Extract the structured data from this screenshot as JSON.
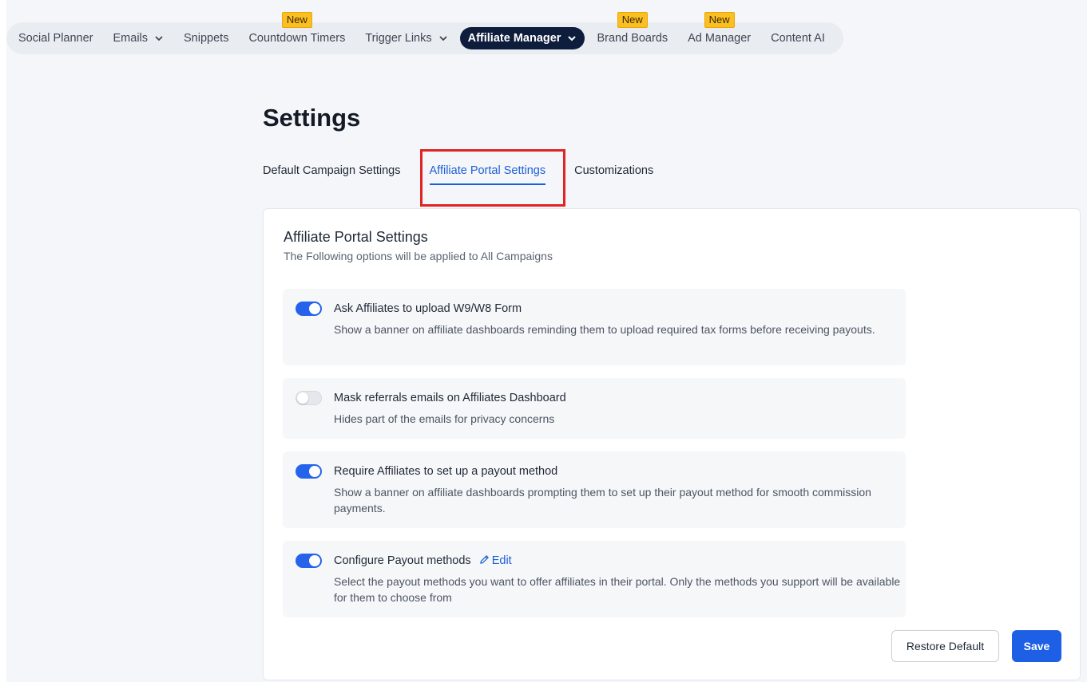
{
  "nav": {
    "items": [
      {
        "label": "Social Planner",
        "badge": "",
        "dropdown": false
      },
      {
        "label": "Emails",
        "badge": "",
        "dropdown": true
      },
      {
        "label": "Snippets",
        "badge": "",
        "dropdown": false
      },
      {
        "label": "Countdown Timers",
        "badge": "New",
        "dropdown": false
      },
      {
        "label": "Trigger Links",
        "badge": "",
        "dropdown": true
      },
      {
        "label": "Affiliate Manager",
        "badge": "",
        "dropdown": true
      },
      {
        "label": "Brand Boards",
        "badge": "New",
        "dropdown": false
      },
      {
        "label": "Ad Manager",
        "badge": "New",
        "dropdown": false
      },
      {
        "label": "Content AI",
        "badge": "",
        "dropdown": false
      }
    ],
    "active": "Affiliate Manager"
  },
  "page": {
    "title": "Settings"
  },
  "tabs": [
    {
      "label": "Default Campaign Settings"
    },
    {
      "label": "Affiliate Portal Settings"
    },
    {
      "label": "Customizations"
    }
  ],
  "card": {
    "title": "Affiliate Portal Settings",
    "subtitle": "The Following options will be applied to All Campaigns",
    "options": [
      {
        "title": "Ask Affiliates to upload W9/W8 Form",
        "description": "Show a banner on affiliate dashboards reminding them to upload required tax forms before receiving payouts.",
        "enabled": true
      },
      {
        "title": "Mask referrals emails on Affiliates Dashboard",
        "description": "Hides part of the emails for privacy concerns",
        "enabled": false
      },
      {
        "title": "Require Affiliates to set up a payout method",
        "description": "Show a banner on affiliate dashboards prompting them to set up their payout method for smooth commission payments.",
        "enabled": true
      },
      {
        "title": "Configure Payout methods",
        "description": "Select the payout methods you want to offer affiliates in their portal. Only the methods you support will be available for them to choose from",
        "enabled": true,
        "edit_label": "Edit"
      }
    ],
    "restore_label": "Restore Default",
    "save_label": "Save"
  },
  "colors": {
    "accent": "#1d5fe5",
    "nav_active": "#0f1d3d",
    "badge": "#fbbf24",
    "highlight": "#e02424"
  }
}
